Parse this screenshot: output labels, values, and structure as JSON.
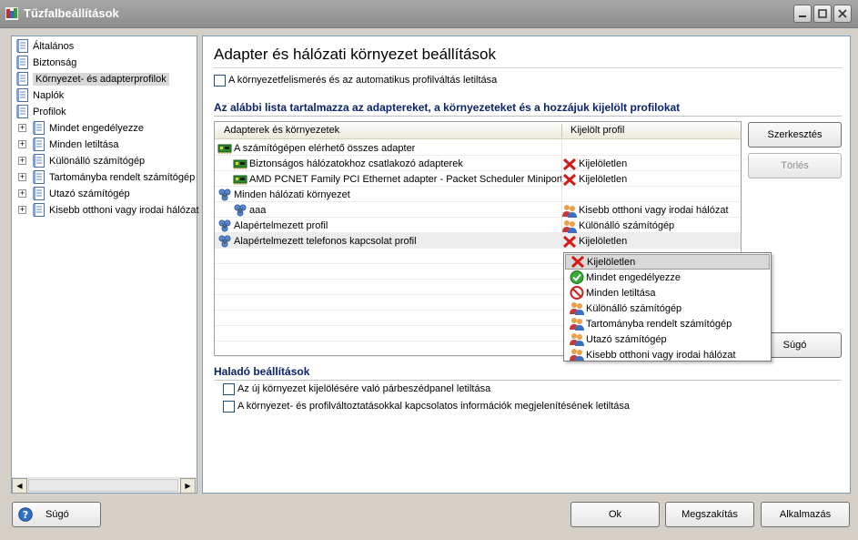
{
  "window": {
    "title": "Tűzfalbeállítások"
  },
  "tree": {
    "items": [
      {
        "label": "Általános",
        "level": 0,
        "expandable": false
      },
      {
        "label": "Biztonság",
        "level": 0,
        "expandable": false
      },
      {
        "label": "Környezet- és adapterprofilok",
        "level": 0,
        "expandable": false,
        "selected": true
      },
      {
        "label": "Naplók",
        "level": 0,
        "expandable": false
      },
      {
        "label": "Profilok",
        "level": 0,
        "expandable": false
      },
      {
        "label": "Mindet engedélyezze",
        "level": 1,
        "expandable": true
      },
      {
        "label": "Minden letiltása",
        "level": 1,
        "expandable": true
      },
      {
        "label": "Különálló számítógép",
        "level": 1,
        "expandable": true
      },
      {
        "label": "Tartományba rendelt számítógép",
        "level": 1,
        "expandable": true
      },
      {
        "label": "Utazó számítógép",
        "level": 1,
        "expandable": true
      },
      {
        "label": "Kisebb otthoni vagy irodai hálózat",
        "level": 1,
        "expandable": true
      }
    ]
  },
  "main": {
    "title": "Adapter és hálózati környezet beállítások",
    "auto_detect_label": "A környezetfelismerés és az automatikus profilváltás letiltása",
    "list_section_title": "Az alábbi lista tartalmazza az adaptereket, a környezeteket és a hozzájuk kijelölt profilokat",
    "columns": [
      "Adapterek és környezetek",
      "Kijelölt profil"
    ],
    "rows": [
      {
        "name": "A számítógépen elérhető összes adapter",
        "indent": 0,
        "icon": "network-adapter-icon",
        "profile": "",
        "profile_icon": ""
      },
      {
        "name": "Biztonságos hálózatokhoz csatlakozó adapterek",
        "indent": 1,
        "icon": "network-adapter-icon",
        "profile": "Kijelöletlen",
        "profile_icon": "red-x-icon"
      },
      {
        "name": "AMD PCNET Family PCI Ethernet adapter - Packet Scheduler Miniport",
        "indent": 1,
        "icon": "network-adapter-icon",
        "profile": "Kijelöletlen",
        "profile_icon": "red-x-icon"
      },
      {
        "name": "Minden hálózati környezet",
        "indent": 0,
        "icon": "network-environment-icon",
        "profile": "",
        "profile_icon": ""
      },
      {
        "name": "aaa",
        "indent": 1,
        "icon": "network-environment-icon",
        "profile": "Kisebb otthoni vagy irodai hálózat",
        "profile_icon": "users-icon"
      },
      {
        "name": "Alapértelmezett profil",
        "indent": 0,
        "icon": "network-environment-icon",
        "profile": "Különálló számítógép",
        "profile_icon": "users-icon"
      },
      {
        "name": "Alapértelmezett telefonos kapcsolat profil",
        "indent": 0,
        "icon": "network-environment-icon",
        "profile": "Kijelöletlen",
        "profile_icon": "red-x-icon",
        "highlighted": true
      }
    ],
    "edit_button": "Szerkesztés",
    "delete_button": "Törlés",
    "help_button": "Súgó",
    "profile_dropdown": {
      "options": [
        {
          "label": "Kijelöletlen",
          "icon": "red-x-icon",
          "selected": true
        },
        {
          "label": "Mindet engedélyezze",
          "icon": "green-check-icon"
        },
        {
          "label": "Minden letiltása",
          "icon": "block-icon"
        },
        {
          "label": "Különálló számítógép",
          "icon": "users-icon"
        },
        {
          "label": "Tartományba rendelt számítógép",
          "icon": "users-icon"
        },
        {
          "label": "Utazó számítógép",
          "icon": "users-icon"
        },
        {
          "label": "Kisebb otthoni vagy irodai hálózat",
          "icon": "users-icon"
        }
      ]
    },
    "advanced": {
      "title": "Haladó beállítások",
      "options": [
        "Az új környezet kijelölésére való párbeszédpanel letiltása",
        "A környezet- és profilváltoztatásokkal kapcsolatos információk megjelenítésének letiltása"
      ]
    }
  },
  "footer": {
    "help": "Súgó",
    "ok": "Ok",
    "cancel": "Megszakítás",
    "apply": "Alkalmazás"
  }
}
